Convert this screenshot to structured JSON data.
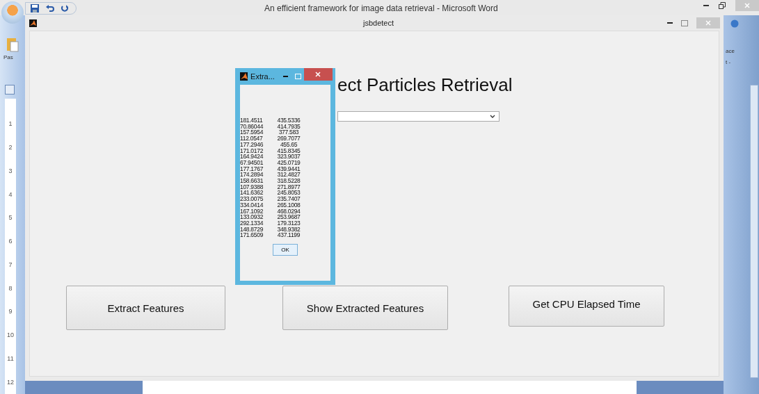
{
  "word_window": {
    "title": "An efficient framework for image data retrieval - Microsoft Word",
    "left_ribbon_label": "Pas",
    "right_ribbon_labels": [
      "ace",
      "t -"
    ],
    "ruler_numbers": [
      "1",
      "2",
      "3",
      "4",
      "5",
      "6",
      "7",
      "8",
      "9",
      "10",
      "11",
      "12"
    ]
  },
  "app_window": {
    "title": "jsbdetect",
    "heading": "ect Particles Retrieval",
    "buttons": [
      {
        "label": "Extract Features"
      },
      {
        "label": "Show Extracted Features"
      },
      {
        "label": "Get CPU Elapsed Time"
      }
    ]
  },
  "dialog": {
    "title": "Extra...",
    "rows": [
      [
        "181.4511",
        "435.5336"
      ],
      [
        "70.86044",
        "414.7935"
      ],
      [
        "157.5954",
        "377.583"
      ],
      [
        "112.0547",
        "269.7077"
      ],
      [
        "177.2946",
        "455.65"
      ],
      [
        "171.0172",
        "415.8345"
      ],
      [
        "164.9424",
        "323.9037"
      ],
      [
        "67.94501",
        "425.0719"
      ],
      [
        "177.1767",
        "439.9441"
      ],
      [
        "174.2894",
        "312.4827"
      ],
      [
        "158.6631",
        "318.5228"
      ],
      [
        "107.9388",
        "271.8977"
      ],
      [
        "141.6362",
        "245.8053"
      ],
      [
        "233.0075",
        "235.7407"
      ],
      [
        "334.0414",
        "265.1008"
      ],
      [
        "167.1092",
        "468.0294"
      ],
      [
        "133.0932",
        "253.9687"
      ],
      [
        "292.1334",
        "179.3123"
      ],
      [
        "148.8729",
        "348.9382"
      ],
      [
        "171.6509",
        "437.1199"
      ]
    ],
    "ok_button": "OK"
  }
}
